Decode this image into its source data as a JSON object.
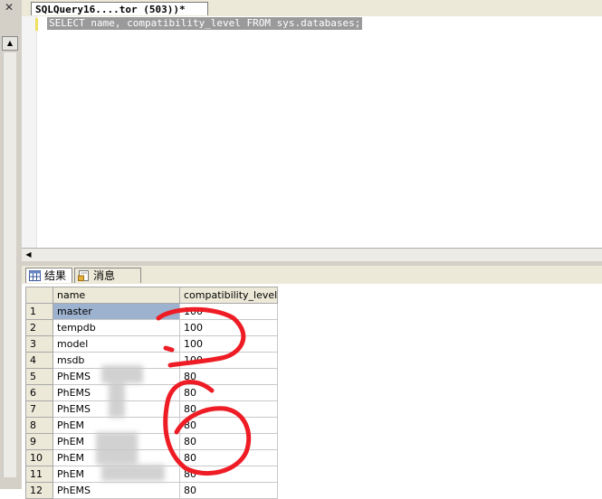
{
  "editor": {
    "tab_title": "SQLQuery16....tor (503))*",
    "sql": "SELECT name, compatibility_level FROM sys.databases;"
  },
  "results": {
    "tabs": [
      {
        "label": "结果",
        "icon": "grid-icon",
        "active": true
      },
      {
        "label": "消息",
        "icon": "message-icon",
        "active": false
      }
    ],
    "columns": [
      "name",
      "compatibility_level"
    ],
    "rows": [
      {
        "num": "1",
        "name": "master",
        "level": "100"
      },
      {
        "num": "2",
        "name": "tempdb",
        "level": "100"
      },
      {
        "num": "3",
        "name": "model",
        "level": "100"
      },
      {
        "num": "4",
        "name": "msdb",
        "level": "100"
      },
      {
        "num": "5",
        "name": "PhEMS",
        "level": "80"
      },
      {
        "num": "6",
        "name": "PhEMS",
        "level": "80"
      },
      {
        "num": "7",
        "name": "PhEMS",
        "level": "80"
      },
      {
        "num": "8",
        "name": "PhEM",
        "level": "80"
      },
      {
        "num": "9",
        "name": "PhEM",
        "level": "80"
      },
      {
        "num": "10",
        "name": "PhEM",
        "level": "80"
      },
      {
        "num": "11",
        "name": "PhEM",
        "level": "80"
      },
      {
        "num": "12",
        "name": "PhEMS",
        "level": "80"
      }
    ]
  },
  "annotation": {
    "color": "#ee1c24",
    "digits_drawn": "26"
  },
  "colors": {
    "chrome": "#ece9d8",
    "selected_cell": "#9db2cf",
    "sql_highlight": "#9a9a9a"
  }
}
